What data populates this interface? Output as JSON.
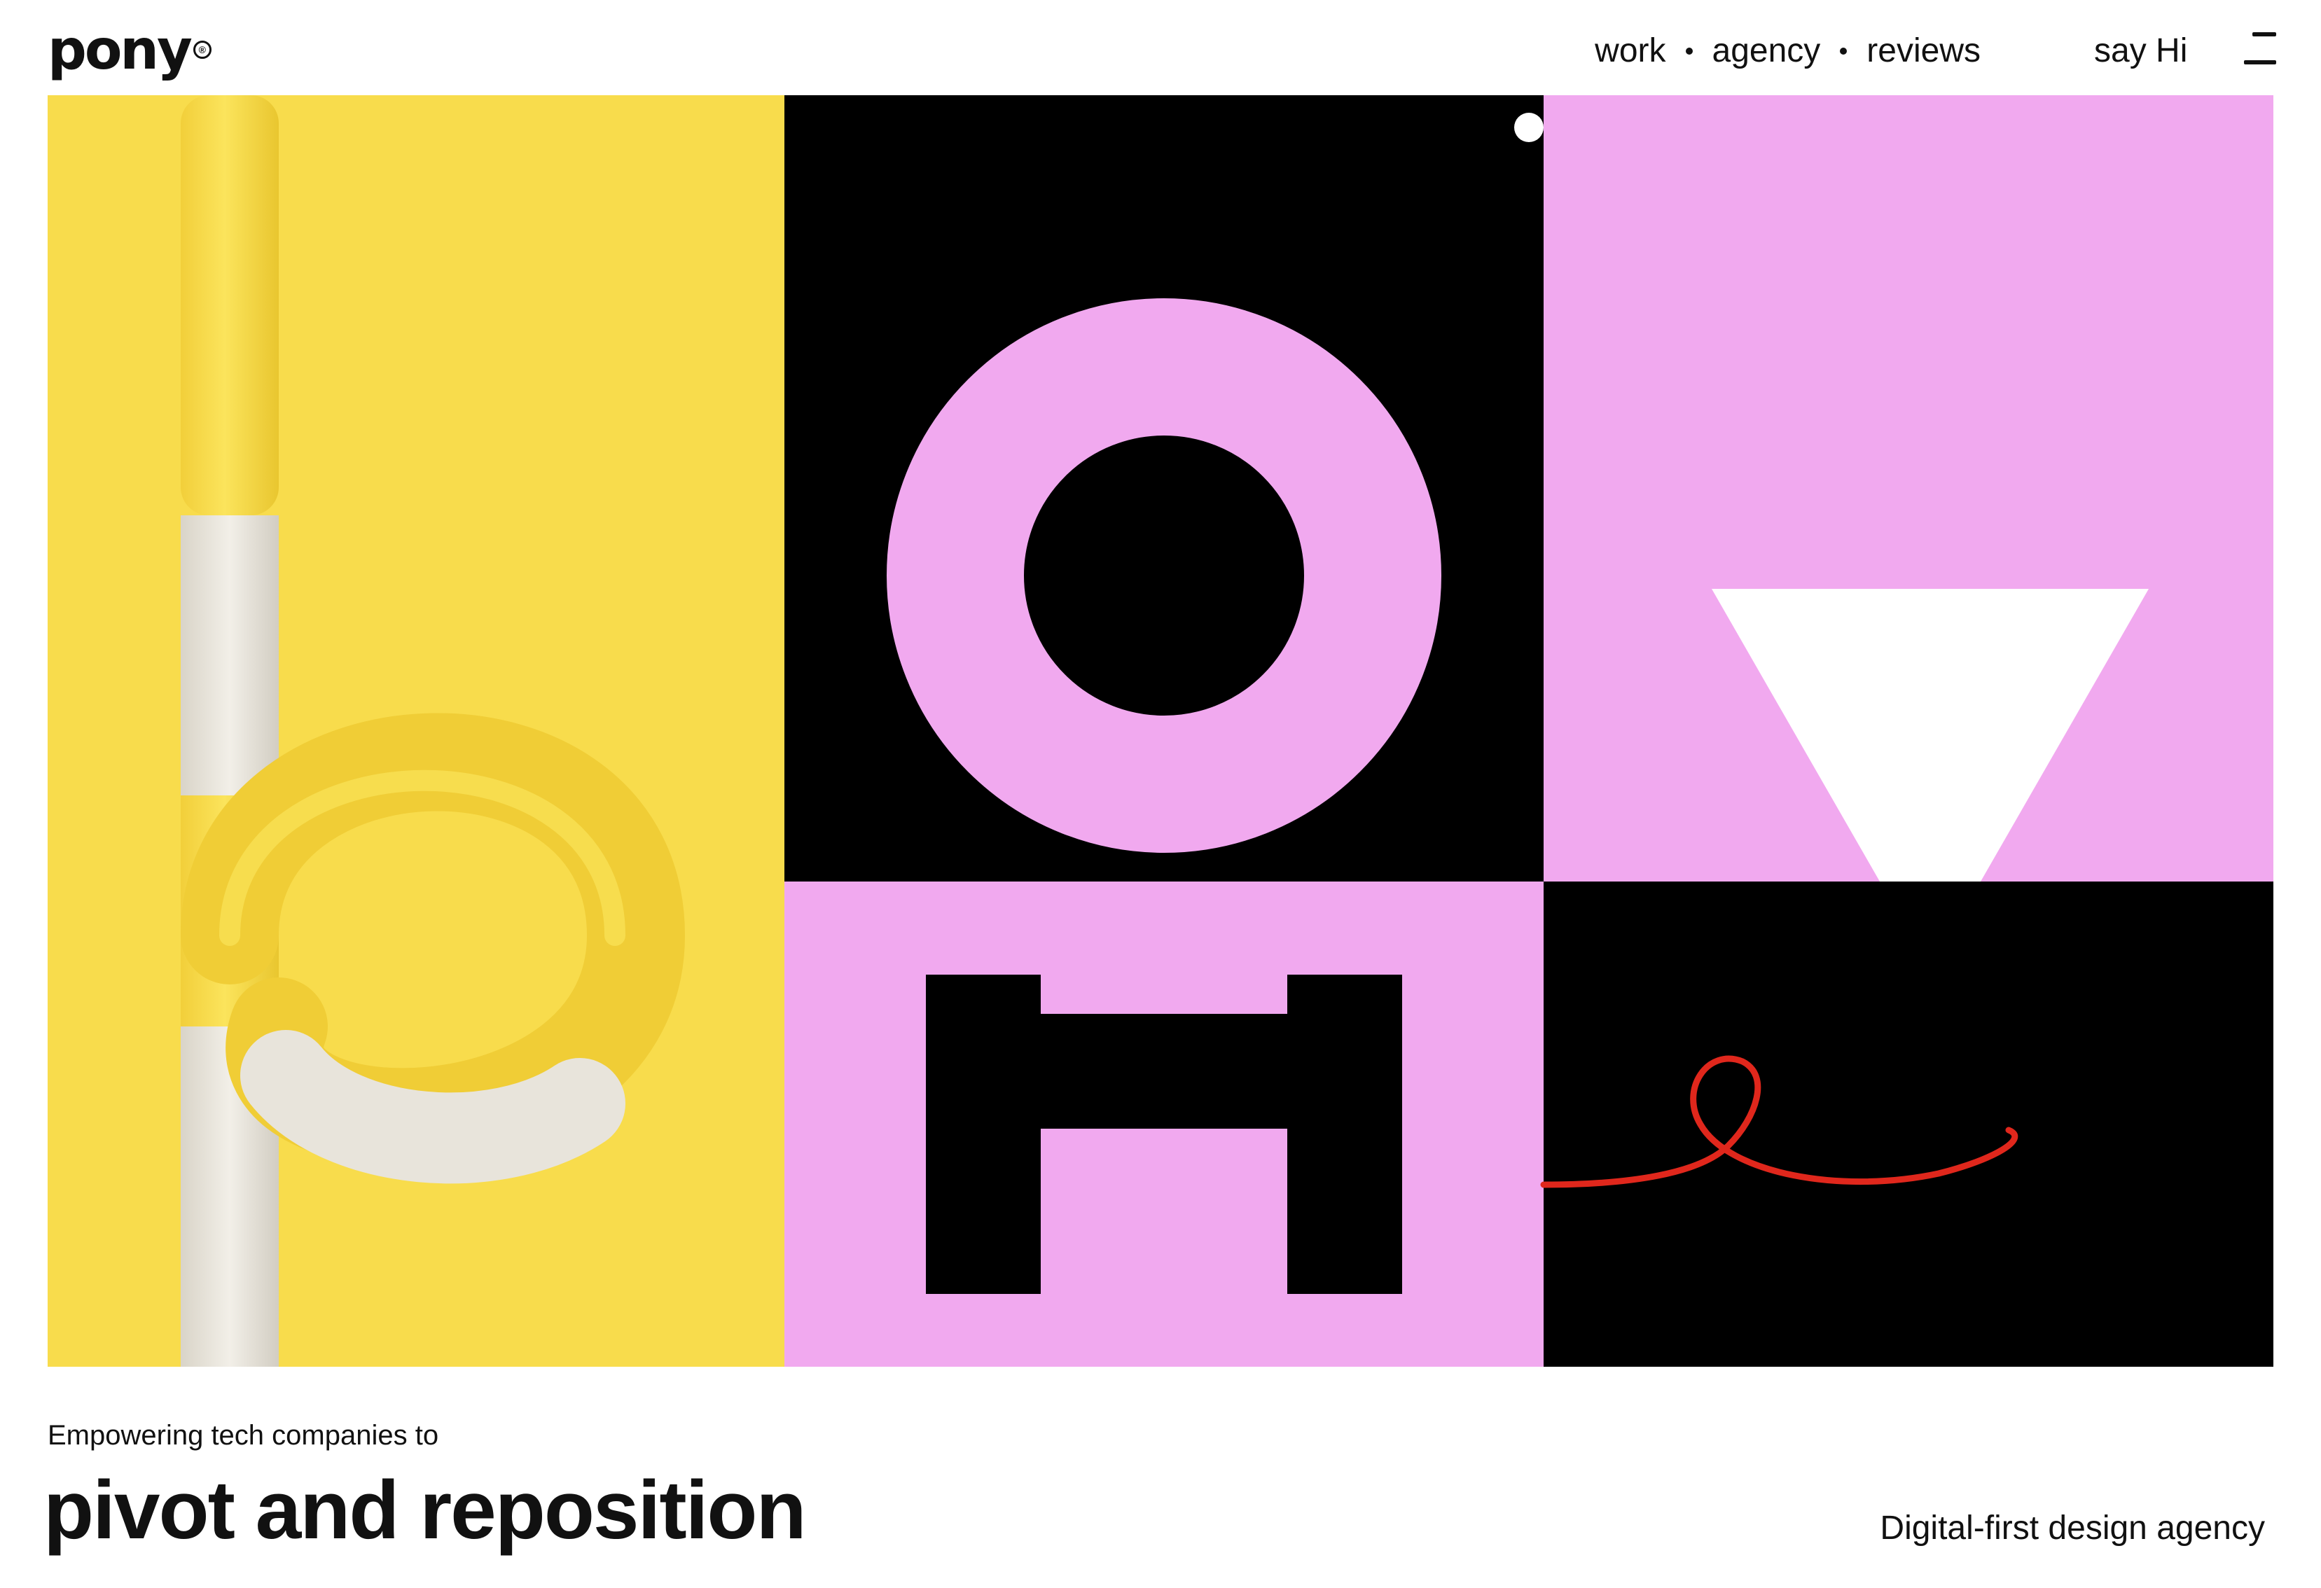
{
  "brand": {
    "logo_text": "pony",
    "logo_mark": "®"
  },
  "nav": {
    "items": [
      {
        "label": "work"
      },
      {
        "label": "agency"
      },
      {
        "label": "reviews"
      }
    ]
  },
  "header": {
    "cta_label": "say Hi",
    "menu_icon": "hamburger-menu-icon"
  },
  "hero": {
    "letters": [
      "p",
      "o",
      "v",
      "H",
      "e"
    ],
    "colors": {
      "yellow": "#f8dc4c",
      "pink": "#f1a9ef",
      "black": "#000000",
      "white": "#ffffff",
      "red": "#e0271c",
      "cream": "#ece8e0"
    }
  },
  "content": {
    "tagline": "Empowering tech companies to",
    "headline": "pivot and reposition",
    "subline": "Digital-first design agency"
  }
}
